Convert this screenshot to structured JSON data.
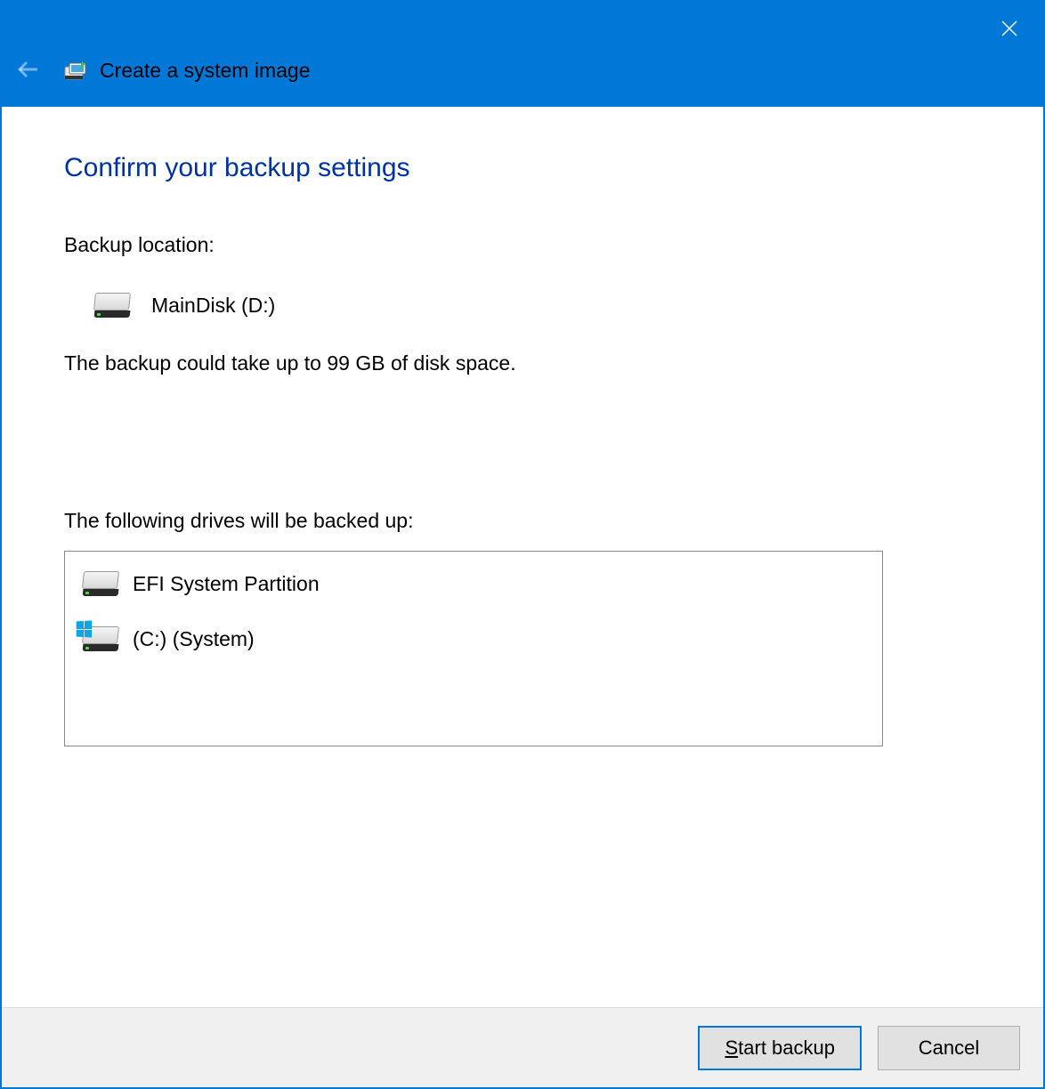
{
  "window": {
    "title": "Create a system image"
  },
  "content": {
    "heading": "Confirm your backup settings",
    "backup_location_label": "Backup location:",
    "backup_location_value": "MainDisk (D:)",
    "space_estimate": "The backup could take up to 99 GB of disk space.",
    "drives_label": "The following drives will be backed up:",
    "drives": [
      {
        "name": "EFI System Partition",
        "type": "plain"
      },
      {
        "name": "(C:) (System)",
        "type": "windows"
      }
    ]
  },
  "footer": {
    "start_label": "Start backup",
    "cancel_label": "Cancel"
  }
}
